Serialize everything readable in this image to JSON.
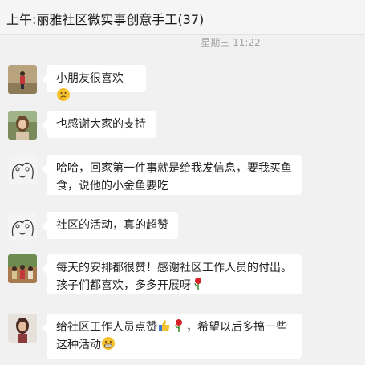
{
  "chat": {
    "title": "上午:丽雅社区微实事创意手工(37)",
    "timestamp": "星期三 11:22"
  },
  "messages": [
    {
      "text": "小朋友很喜欢",
      "avatar": "child-photo-avatar",
      "emoji": "thinking-face-icon"
    },
    {
      "text": "也感谢大家的支持",
      "avatar": "woman-photo-avatar"
    },
    {
      "text_line1": "哈哈，回家第一件事就是给我发信息，要我买鱼",
      "text_line2": "食，说他的小金鱼要吃",
      "avatar": "line-drawing-avatar"
    },
    {
      "text": "社区的活动，真的超赞",
      "avatar": "line-drawing-avatar"
    },
    {
      "text_line1": "每天的安排都很赞！感谢社区工作人员的付出。",
      "text_line2": "孩子们都喜欢，多多开展呀",
      "avatar": "group-photo-avatar",
      "emoji": "rose-icon"
    },
    {
      "text_line1a": "给社区工作人员点赞",
      "text_line1b": "，希望以后多搞一些",
      "text_line2": "这种活动",
      "avatar": "portrait-avatar",
      "emojis": [
        "thumbs-up-icon",
        "rose-icon",
        "grinning-face-icon"
      ]
    }
  ]
}
